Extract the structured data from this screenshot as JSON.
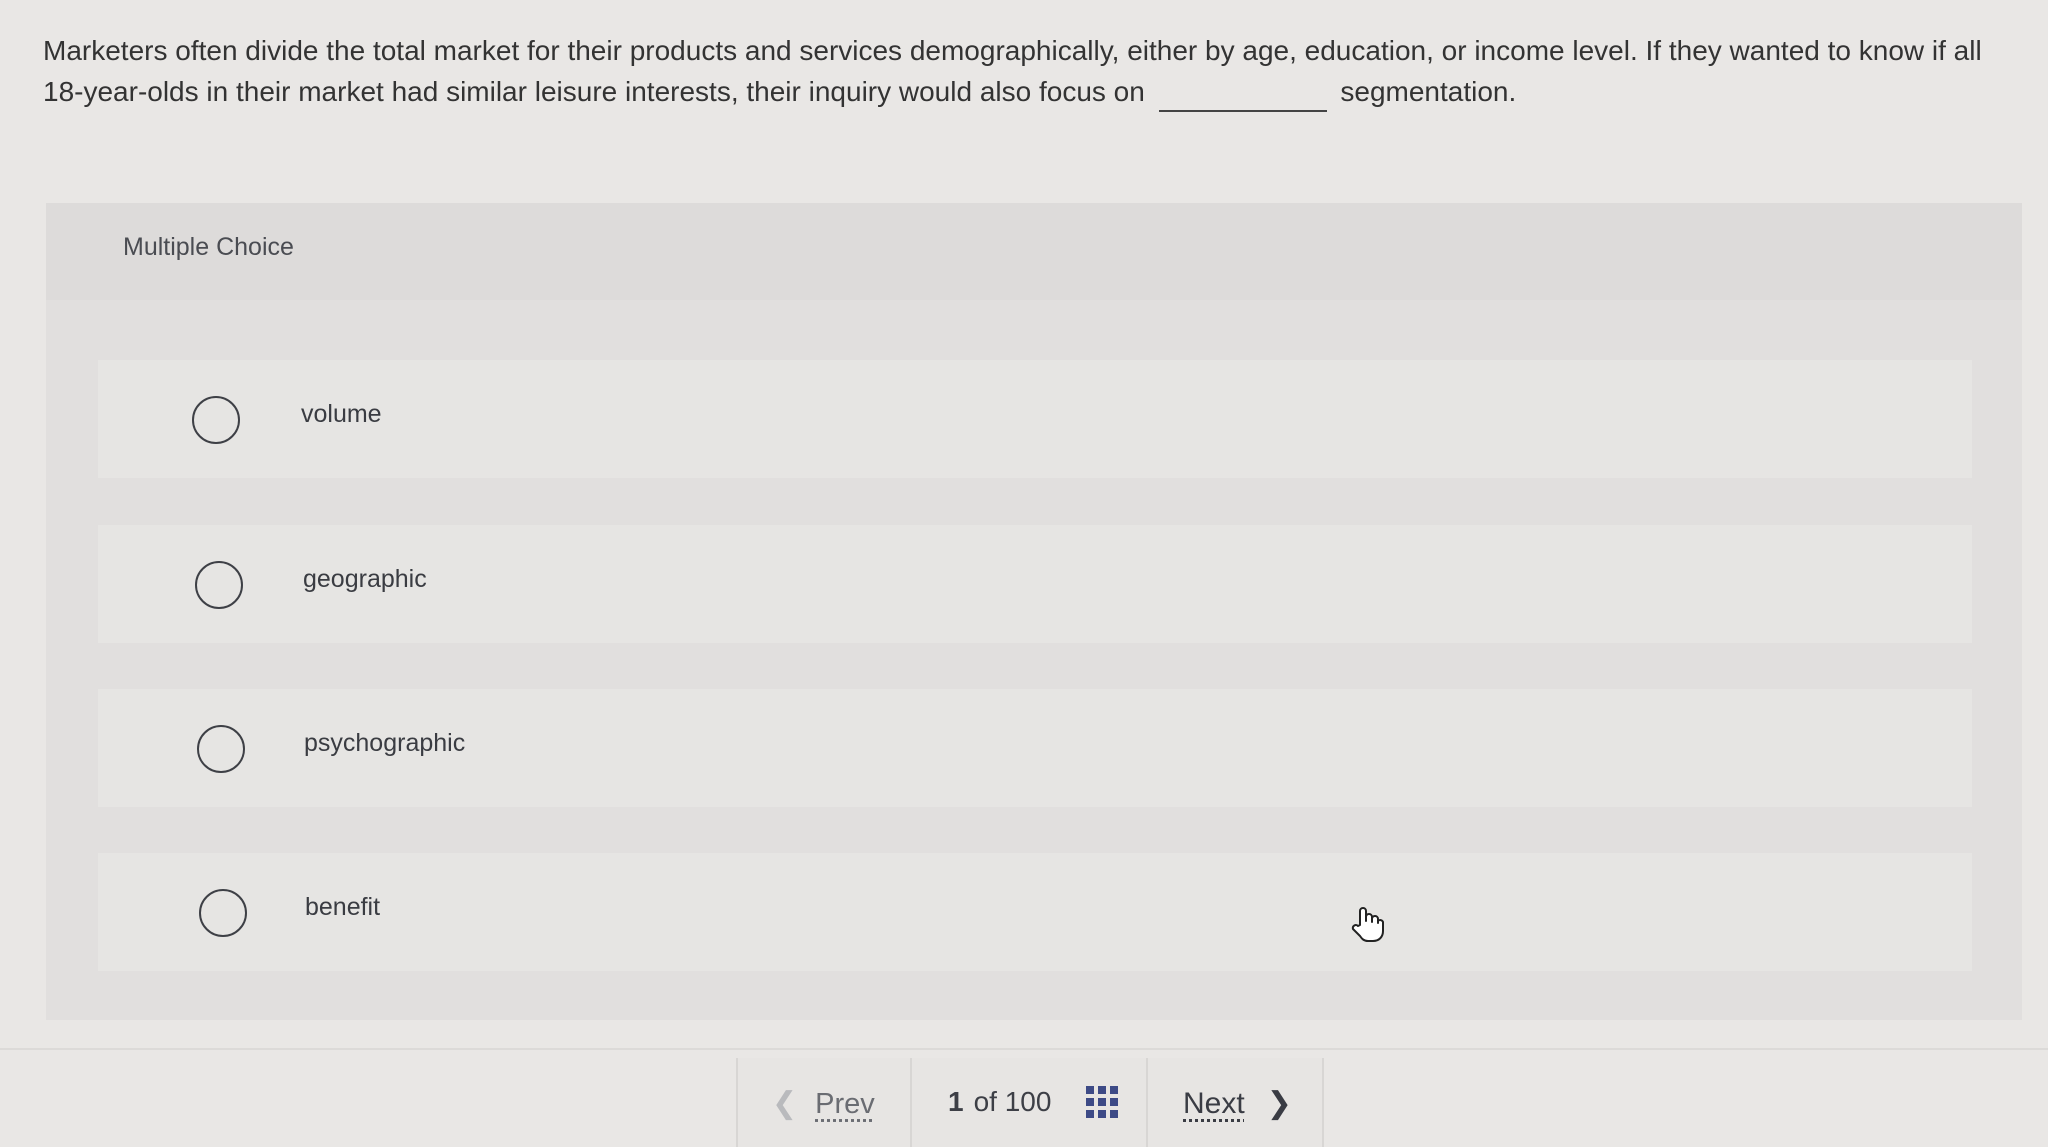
{
  "question": {
    "text_before": "Marketers often divide the total market for their products and services demographically, either by age, education, or income level. If they wanted to know if all 18-year-olds in their market had similar leisure interests, their inquiry would also focus on",
    "text_after": "segmentation."
  },
  "panel": {
    "title": "Multiple Choice",
    "options": [
      {
        "label": "volume"
      },
      {
        "label": "geographic"
      },
      {
        "label": "psychographic"
      },
      {
        "label": "benefit"
      }
    ]
  },
  "nav": {
    "prev_label": "Prev",
    "current_page": "1",
    "of_label": "of",
    "total_pages": "100",
    "next_label": "Next"
  },
  "icons": {
    "prev": "chevron-left-icon",
    "grid": "grid-icon",
    "next": "chevron-right-icon",
    "cursor": "hand-pointer-icon"
  },
  "colors": {
    "grid_icon": "#3d4a86",
    "background": "#e9e7e5"
  }
}
